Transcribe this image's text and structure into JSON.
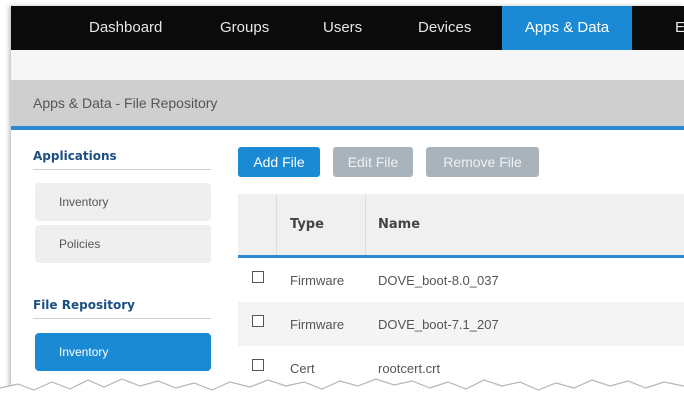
{
  "nav": {
    "tabs": [
      {
        "label": "Dashboard",
        "active": false
      },
      {
        "label": "Groups",
        "active": false
      },
      {
        "label": "Users",
        "active": false
      },
      {
        "label": "Devices",
        "active": false
      },
      {
        "label": "Apps & Data",
        "active": true
      },
      {
        "label": "E",
        "active": false
      }
    ]
  },
  "page": {
    "title": "Apps & Data - File Repository"
  },
  "sidebar": {
    "sections": [
      {
        "heading": "Applications",
        "items": [
          {
            "label": "Inventory",
            "active": false
          },
          {
            "label": "Policies",
            "active": false
          }
        ]
      },
      {
        "heading": "File Repository",
        "items": [
          {
            "label": "Inventory",
            "active": true
          }
        ]
      }
    ]
  },
  "toolbar": {
    "add_label": "Add File",
    "edit_label": "Edit File",
    "remove_label": "Remove File"
  },
  "table": {
    "columns": [
      "Type",
      "Name"
    ],
    "rows": [
      {
        "type": "Firmware",
        "name": "DOVE_boot-8.0_037",
        "checked": false
      },
      {
        "type": "Firmware",
        "name": "DOVE_boot-7.1_207",
        "checked": false
      },
      {
        "type": "Cert",
        "name": "rootcert.crt",
        "checked": false
      }
    ]
  },
  "colors": {
    "accent": "#1a8ad4",
    "nav_bg": "#0b0b0b",
    "header_bg": "#cfcfcf"
  }
}
